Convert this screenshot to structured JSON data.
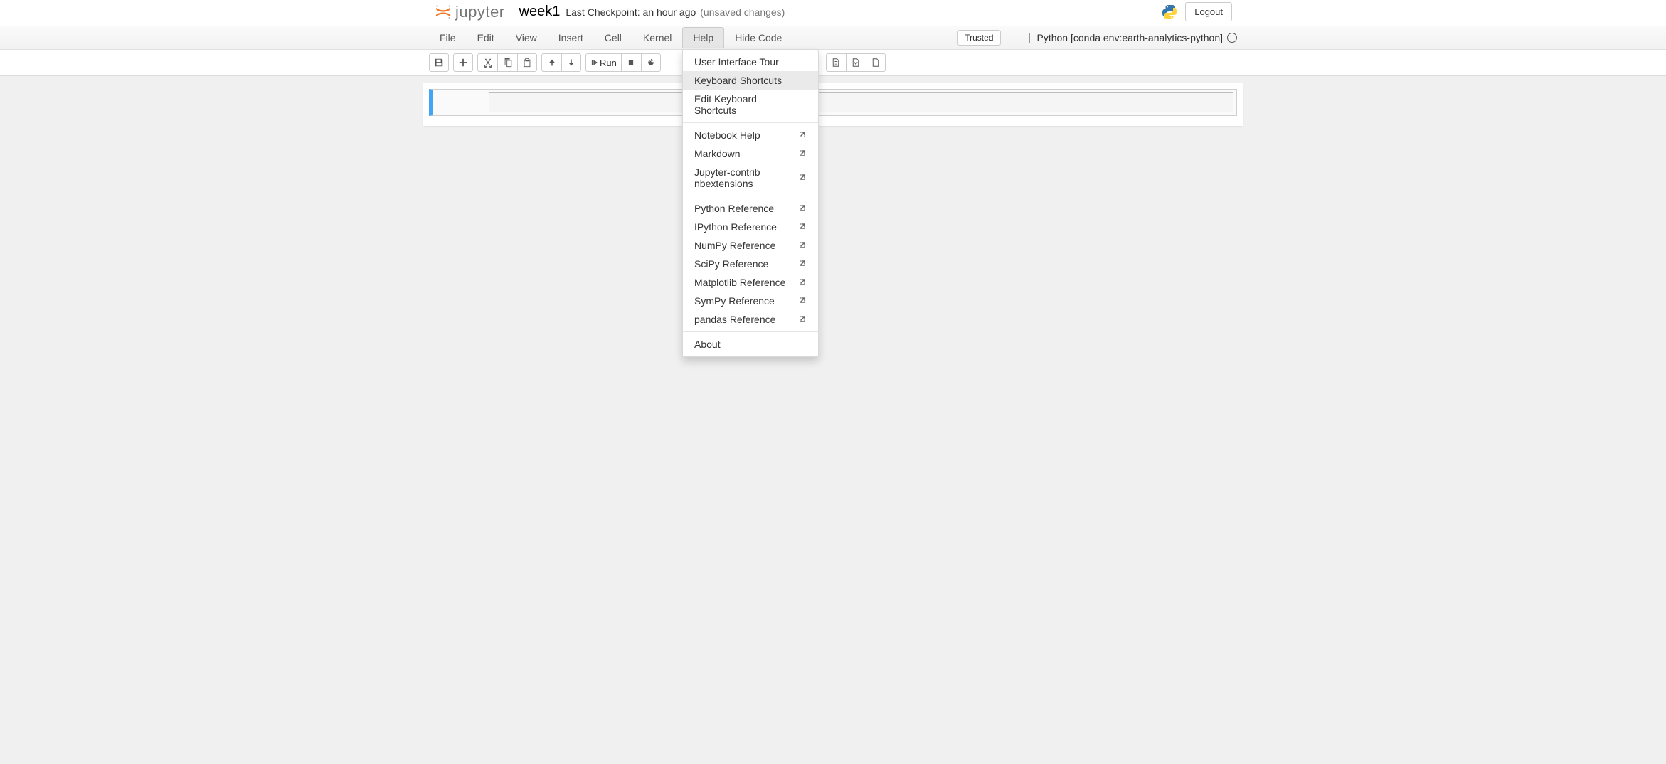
{
  "header": {
    "logo_text": "jupyter",
    "notebook_name": "week1",
    "checkpoint": "Last Checkpoint: an hour ago",
    "unsaved": "(unsaved changes)",
    "logout": "Logout"
  },
  "menubar": {
    "items": [
      "File",
      "Edit",
      "View",
      "Insert",
      "Cell",
      "Kernel",
      "Help",
      "Hide Code"
    ],
    "active_index": 6,
    "trusted": "Trusted",
    "kernel_name": "Python [conda env:earth-analytics-python]"
  },
  "toolbar": {
    "run": "Run"
  },
  "cell": {
    "prompt": "",
    "code": ""
  },
  "help_menu": {
    "groups": [
      [
        {
          "label": "User Interface Tour",
          "ext": false
        },
        {
          "label": "Keyboard Shortcuts",
          "ext": false,
          "hl": true
        },
        {
          "label": "Edit Keyboard Shortcuts",
          "ext": false
        }
      ],
      [
        {
          "label": "Notebook Help",
          "ext": true
        },
        {
          "label": "Markdown",
          "ext": true
        },
        {
          "label": "Jupyter-contrib nbextensions",
          "ext": true
        }
      ],
      [
        {
          "label": "Python Reference",
          "ext": true
        },
        {
          "label": "IPython Reference",
          "ext": true
        },
        {
          "label": "NumPy Reference",
          "ext": true
        },
        {
          "label": "SciPy Reference",
          "ext": true
        },
        {
          "label": "Matplotlib Reference",
          "ext": true
        },
        {
          "label": "SymPy Reference",
          "ext": true
        },
        {
          "label": "pandas Reference",
          "ext": true
        }
      ],
      [
        {
          "label": "About",
          "ext": false
        }
      ]
    ]
  }
}
